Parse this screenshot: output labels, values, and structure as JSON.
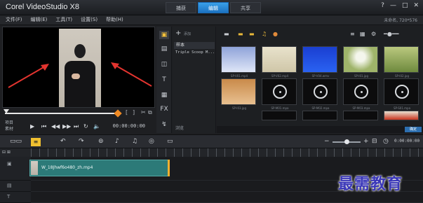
{
  "window": {
    "title": "Corel VideoStudio X8",
    "mode_tabs": [
      "捕获",
      "编辑",
      "共享"
    ],
    "active_tab": "编辑",
    "controls": [
      "?",
      "—",
      "□",
      "✕"
    ]
  },
  "menu": {
    "items": [
      "文件(F)",
      "编辑(E)",
      "工具(T)",
      "设置(S)",
      "帮助(H)"
    ],
    "user": "未命名, 720*576"
  },
  "preview": {
    "mode_labels": [
      "项目",
      "素材"
    ],
    "timecode": "00:00:00:00",
    "brackets": [
      "[",
      "]"
    ]
  },
  "tools": {
    "items": [
      "media-icon",
      "instant-project-icon",
      "transition-icon",
      "title-icon",
      "graphic-icon",
      "filter-icon",
      "path-icon"
    ]
  },
  "library": {
    "add_label": "添加",
    "folder_selected": "样本",
    "folder_item": "Triple Scoop M...",
    "browse_label": "浏览",
    "thumbnails": [
      {
        "label": "SP-V01.mp4",
        "kind": "video-sky"
      },
      {
        "label": "SP-V02.mp4",
        "kind": "video-sand"
      },
      {
        "label": "SP-V04.wmv",
        "kind": "video-blue"
      },
      {
        "label": "SP-I01.jpg",
        "kind": "image-dandelion"
      },
      {
        "label": "SP-I02.jpg",
        "kind": "image-grass"
      },
      {
        "label": "SP-I03.jpg",
        "kind": "image-tree"
      },
      {
        "label": "SP-M01.mpa",
        "kind": "audio"
      },
      {
        "label": "SP-M02.mpa",
        "kind": "audio"
      },
      {
        "label": "SP-M03.mpa",
        "kind": "audio"
      },
      {
        "label": "SP-S01.mpa",
        "kind": "audio"
      }
    ],
    "ok_label": "确定"
  },
  "timeline": {
    "timecode": "0:00:00:00",
    "ruler_label": "00:00",
    "clip_name": "W_18Jhwf6o480_zh.mp4"
  },
  "watermark": "最需教育",
  "colors": {
    "accent": "#1c72c1",
    "clip": "#2c7a78",
    "watermark": "#3a37b8",
    "arrow": "#e3342f"
  }
}
